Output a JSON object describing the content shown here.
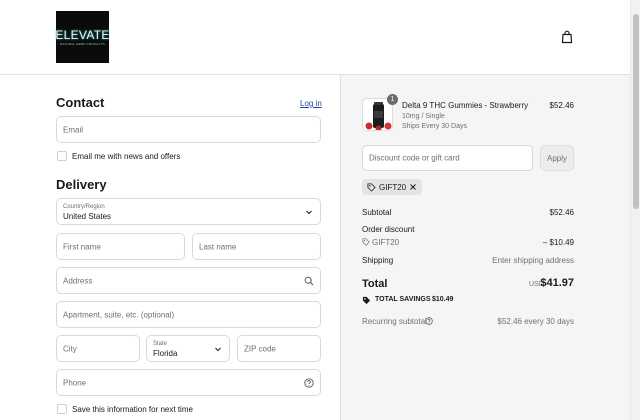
{
  "header": {
    "logo_text": "ELEVATE",
    "logo_subtext": "NATURAL HEMP PRODUCTS"
  },
  "contact": {
    "heading": "Contact",
    "login_link": "Log in",
    "email_placeholder": "Email",
    "news_checkbox_label": "Email me with news and offers"
  },
  "delivery": {
    "heading": "Delivery",
    "country_label": "Country/Region",
    "country_value": "United States",
    "first_name_placeholder": "First name",
    "last_name_placeholder": "Last name",
    "address_placeholder": "Address",
    "apartment_placeholder": "Apartment, suite, etc. (optional)",
    "city_placeholder": "City",
    "state_label": "State",
    "state_value": "Florida",
    "zip_placeholder": "ZIP code",
    "phone_placeholder": "Phone",
    "save_checkbox_label": "Save this information for next time"
  },
  "summary": {
    "product": {
      "quantity": "1",
      "name": "Delta 9 THC Gummies - Strawberry",
      "variant": "10mg / Single",
      "shipping_note": "Ships Every 30 Days",
      "price": "$52.46"
    },
    "discount_placeholder": "Discount code or gift card",
    "apply_label": "Apply",
    "applied_code": "GIFT20",
    "subtotal_label": "Subtotal",
    "subtotal_value": "$52.46",
    "order_discount_label": "Order discount",
    "discount_code": "GIFT20",
    "discount_value": "– $10.49",
    "shipping_label": "Shipping",
    "shipping_value": "Enter shipping address",
    "total_label": "Total",
    "total_currency": "USD",
    "total_value": "$41.97",
    "savings_label": "TOTAL SAVINGS",
    "savings_value": "$10.49",
    "recurring_label": "Recurring subtotal",
    "recurring_value": "$52.46 every 30 days"
  },
  "colors": {
    "link": "#1a4ca3",
    "summary_bg": "#f5f5f5",
    "logo_bg": "#0b0b0b"
  }
}
